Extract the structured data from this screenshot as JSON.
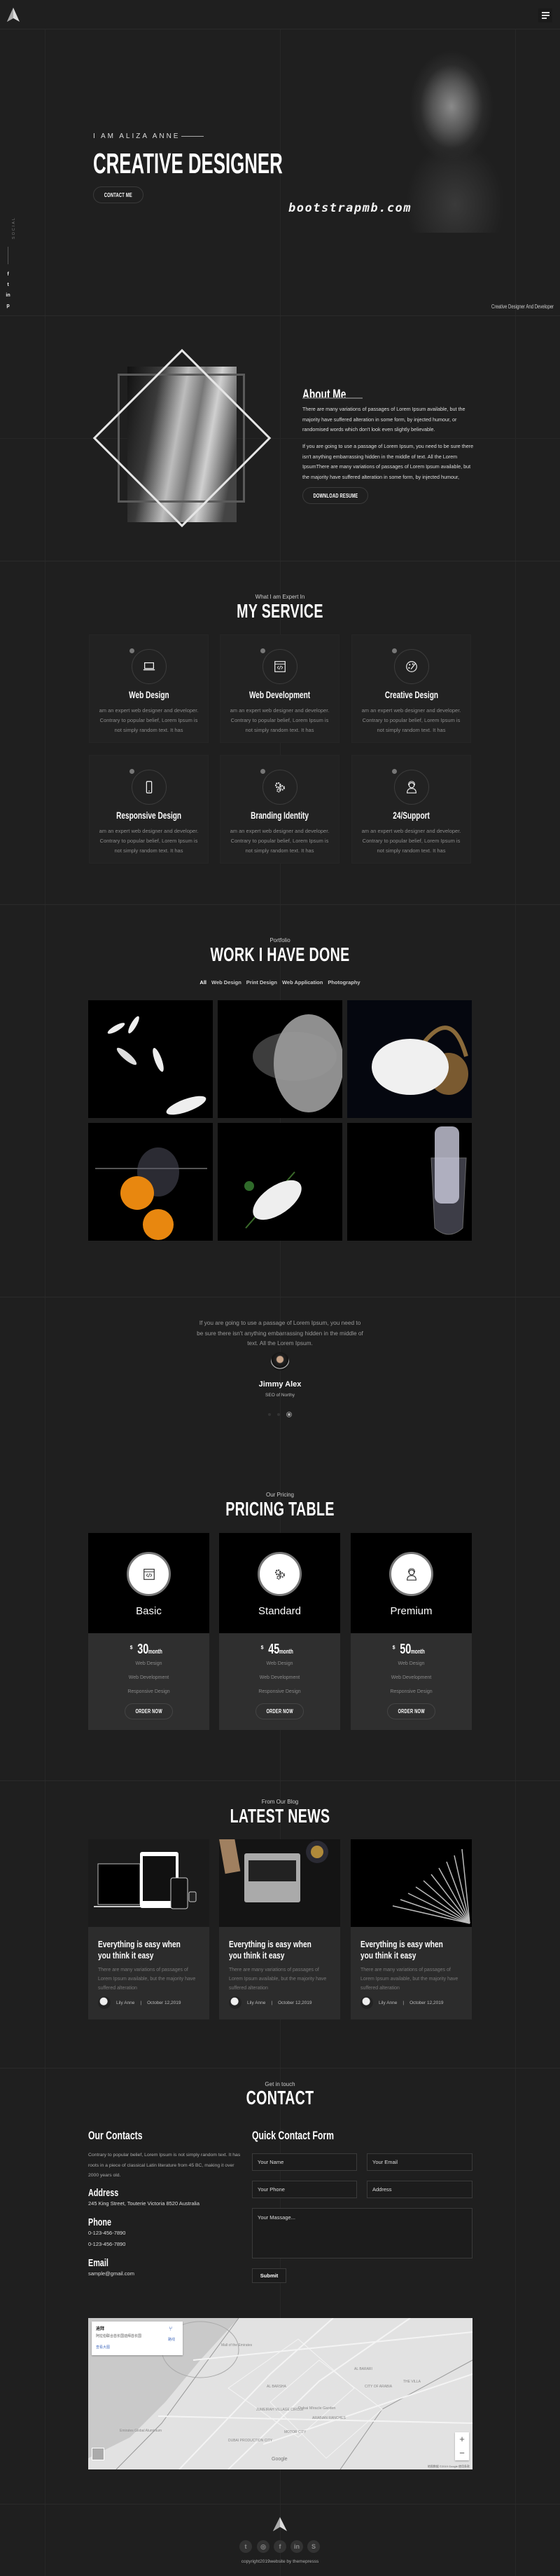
{
  "header": {
    "logo_icon": "triangle-logo-icon",
    "menu_icon": "hamburger-menu-icon"
  },
  "hero": {
    "intro": "I AM ALIZA ANNE",
    "title": "CREATIVE DESIGNER",
    "cta": "CONTACT ME",
    "watermark": "bootstrapmb.com",
    "social_label": "SOCIAL",
    "social": [
      {
        "icon": "facebook-icon",
        "glyph": "f"
      },
      {
        "icon": "twitter-icon",
        "glyph": "t"
      },
      {
        "icon": "linkedin-icon",
        "glyph": "in"
      },
      {
        "icon": "pinterest-icon",
        "glyph": "p"
      }
    ],
    "tagline": "Creative Designer And Developer"
  },
  "about": {
    "title": "About Me",
    "p1": "There are many variations of passages of Lorem Ipsum available, but the majority have suffered alteration in some form, by injected humour, or randomised words which don't look even slightly believable.",
    "p2": "If you are going to use a passage of Lorem Ipsum, you need to be sure there isn't anything embarrassing hidden in the middle of text. All the Lorem IpsumThere are many variations of passages of Lorem Ipsum available, but the majority have suffered alteration in some form, by injected humour,",
    "button": "DOWNLOAD RESUME"
  },
  "services": {
    "subtitle": "What I am Expert In",
    "title": "MY SERVICE",
    "items": [
      {
        "title": "Web Design",
        "icon": "laptop",
        "text": "am an expert web designer and developer. Contrary to popular belief, Lorem Ipsum is not simply random text. It has"
      },
      {
        "title": "Web Development",
        "icon": "code-window",
        "text": "am an expert web designer and developer. Contrary to popular belief, Lorem Ipsum is not simply random text. It has"
      },
      {
        "title": "Creative Design",
        "icon": "palette",
        "text": "am an expert web designer and developer. Contrary to popular belief, Lorem Ipsum is not simply random text. It has"
      },
      {
        "title": "Responsive Design",
        "icon": "mobile",
        "text": "am an expert web designer and developer. Contrary to popular belief, Lorem Ipsum is not simply random text. It has"
      },
      {
        "title": "Branding Identity",
        "icon": "gears",
        "text": "am an expert web designer and developer. Contrary to popular belief, Lorem Ipsum is not simply random text. It has"
      },
      {
        "title": "24/Support",
        "icon": "support-agent",
        "text": "am an expert web designer and developer. Contrary to popular belief, Lorem Ipsum is not simply random text. It has"
      }
    ]
  },
  "portfolio": {
    "subtitle": "Portfolio",
    "title": "WORK I HAVE DONE",
    "filters": [
      "All",
      "Web Design",
      "Print Design",
      "Web Application",
      "Photography"
    ],
    "active_filter": "All",
    "items": [
      "feathers",
      "powder-explosion",
      "white-tulips-basket",
      "oranges-splash",
      "white-blossoms",
      "ice-in-glass"
    ]
  },
  "testimonial": {
    "quote": "If you are going to use a passage of Lorem Ipsum, you need to be sure there isn't anything embarrassing hidden in the middle of text. All the Lorem Ipsum.",
    "name": "Jimmy Alex",
    "role": "SEO of Northy",
    "slide_count": 3,
    "active_slide": 3
  },
  "pricing": {
    "subtitle": "Our Pricing",
    "title": "PRICING TABLE",
    "plans": [
      {
        "name": "Basic",
        "icon": "code-window",
        "currency": "$",
        "price": "30",
        "period": "month",
        "features": [
          "Web Design",
          "Web Development",
          "Responsive Design"
        ],
        "button": "ORDER NOW"
      },
      {
        "name": "Standard",
        "icon": "gears",
        "currency": "$",
        "price": "45",
        "period": "month",
        "features": [
          "Web Design",
          "Web Development",
          "Responsive Design"
        ],
        "button": "ORDER NOW"
      },
      {
        "name": "Premium",
        "icon": "support-agent",
        "currency": "$",
        "price": "50",
        "period": "month",
        "features": [
          "Web Design",
          "Web Development",
          "Responsive Design"
        ],
        "button": "ORDER NOW"
      }
    ]
  },
  "news": {
    "subtitle": "From Our Blog",
    "title": "LATEST NEWS",
    "posts": [
      {
        "title": "Everything is easy when you think it easy",
        "text": "There are many variations of passages of Lorem Ipsum available, but the majority have suffered alteration",
        "author": "Lily Anne",
        "date": "October 12,2019",
        "image": "devices"
      },
      {
        "title": "Everything is easy when you think it easy",
        "text": "There are many variations of passages of Lorem Ipsum available, but the majority have suffered alteration",
        "author": "Lily Anne",
        "date": "October 12,2019",
        "image": "laptop-desk"
      },
      {
        "title": "Everything is easy when you think it easy",
        "text": "There are many variations of passages of Lorem Ipsum available, but the majority have suffered alteration",
        "author": "Lily Anne",
        "date": "October 12,2019",
        "image": "open-book"
      }
    ]
  },
  "contact": {
    "subtitle": "Get in touch",
    "title": "CONTACT",
    "info_title": "Our Contacts",
    "info_text": "Contrary to popular belief, Lorem Ipsum is not simply random text. It has roots in a piece of classical Latin literature from 45 BC, making it over 2000 years old.",
    "address_label": "Address",
    "address": "245 King Street, Touterie Victoria 8520 Australia",
    "phone_label": "Phone",
    "phones": [
      "0-123-456-7890",
      "0-123-456-7890"
    ],
    "email_label": "Email",
    "email": "sample@gmail.com",
    "form_title": "Quick Contact Form",
    "placeholders": {
      "name": "Your Name",
      "email": "Your Email",
      "phone": "Your Phone",
      "address": "Address",
      "message": "Your Massage..."
    },
    "submit": "Submit"
  },
  "map": {
    "place": "迪拜",
    "region": "阿拉伯联合酋长国迪拜酋长国",
    "view_larger": "查看大图",
    "directions": "路线",
    "labels": [
      "Mall of the Emirates",
      "Dubai Miracle Garden",
      "Emirates Global Aluminium",
      "MOTOR CITY",
      "AL BARSHA",
      "CITY OF ARABIA",
      "THE VILLA",
      "AL BARARI",
      "DUBAI PRODUCTION CITY",
      "JUMEIRAH VILLAGE CIRCLE",
      "ARABIAN RANCHES"
    ],
    "google": "Google",
    "attribution": "地图数据 ©2019 Google 使用条款",
    "zoom_in": "+",
    "zoom_out": "−"
  },
  "footer": {
    "social": [
      {
        "icon": "twitter-icon",
        "glyph": "t"
      },
      {
        "icon": "dribbble-icon",
        "glyph": "◎"
      },
      {
        "icon": "facebook-icon",
        "glyph": "f"
      },
      {
        "icon": "linkedin-icon",
        "glyph": "in"
      },
      {
        "icon": "skype-icon",
        "glyph": "S"
      }
    ],
    "copyright": "copyright2019website by themepresss"
  }
}
